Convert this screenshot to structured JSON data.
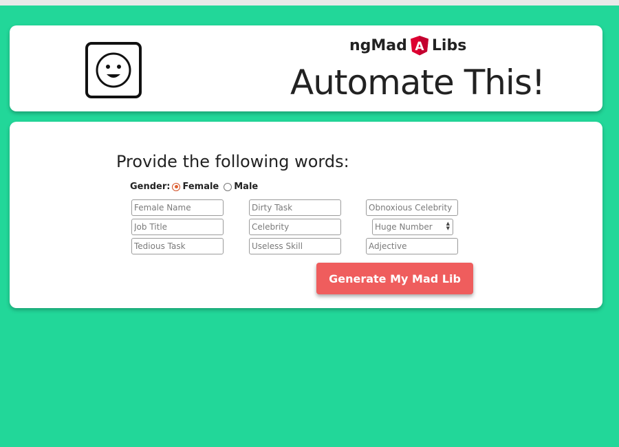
{
  "header": {
    "brand_left": "ngMad",
    "brand_right": "Libs",
    "shield_letter": "A",
    "title": "Automate This!"
  },
  "form": {
    "prompt": "Provide the following words:",
    "gender_label": "Gender:",
    "gender_options": [
      "Female",
      "Male"
    ],
    "selected_gender": "Female",
    "fields": {
      "female_name": "Female Name",
      "dirty_task": "Dirty Task",
      "obnoxious_celebrity": "Obnoxious Celebrity",
      "job_title": "Job Title",
      "celebrity": "Celebrity",
      "huge_number": "Huge Number",
      "tedious_task": "Tedious Task",
      "useless_skill": "Useless Skill",
      "adjective": "Adjective"
    },
    "submit_label": "Generate My Mad Lib"
  },
  "colors": {
    "background": "#22d799",
    "button": "#ef5d5d",
    "radio_accent": "#e2602e",
    "angular_red": "#dd0031"
  },
  "icons": {
    "face": "smiley-face-icon",
    "brand": "angular-shield-icon"
  }
}
